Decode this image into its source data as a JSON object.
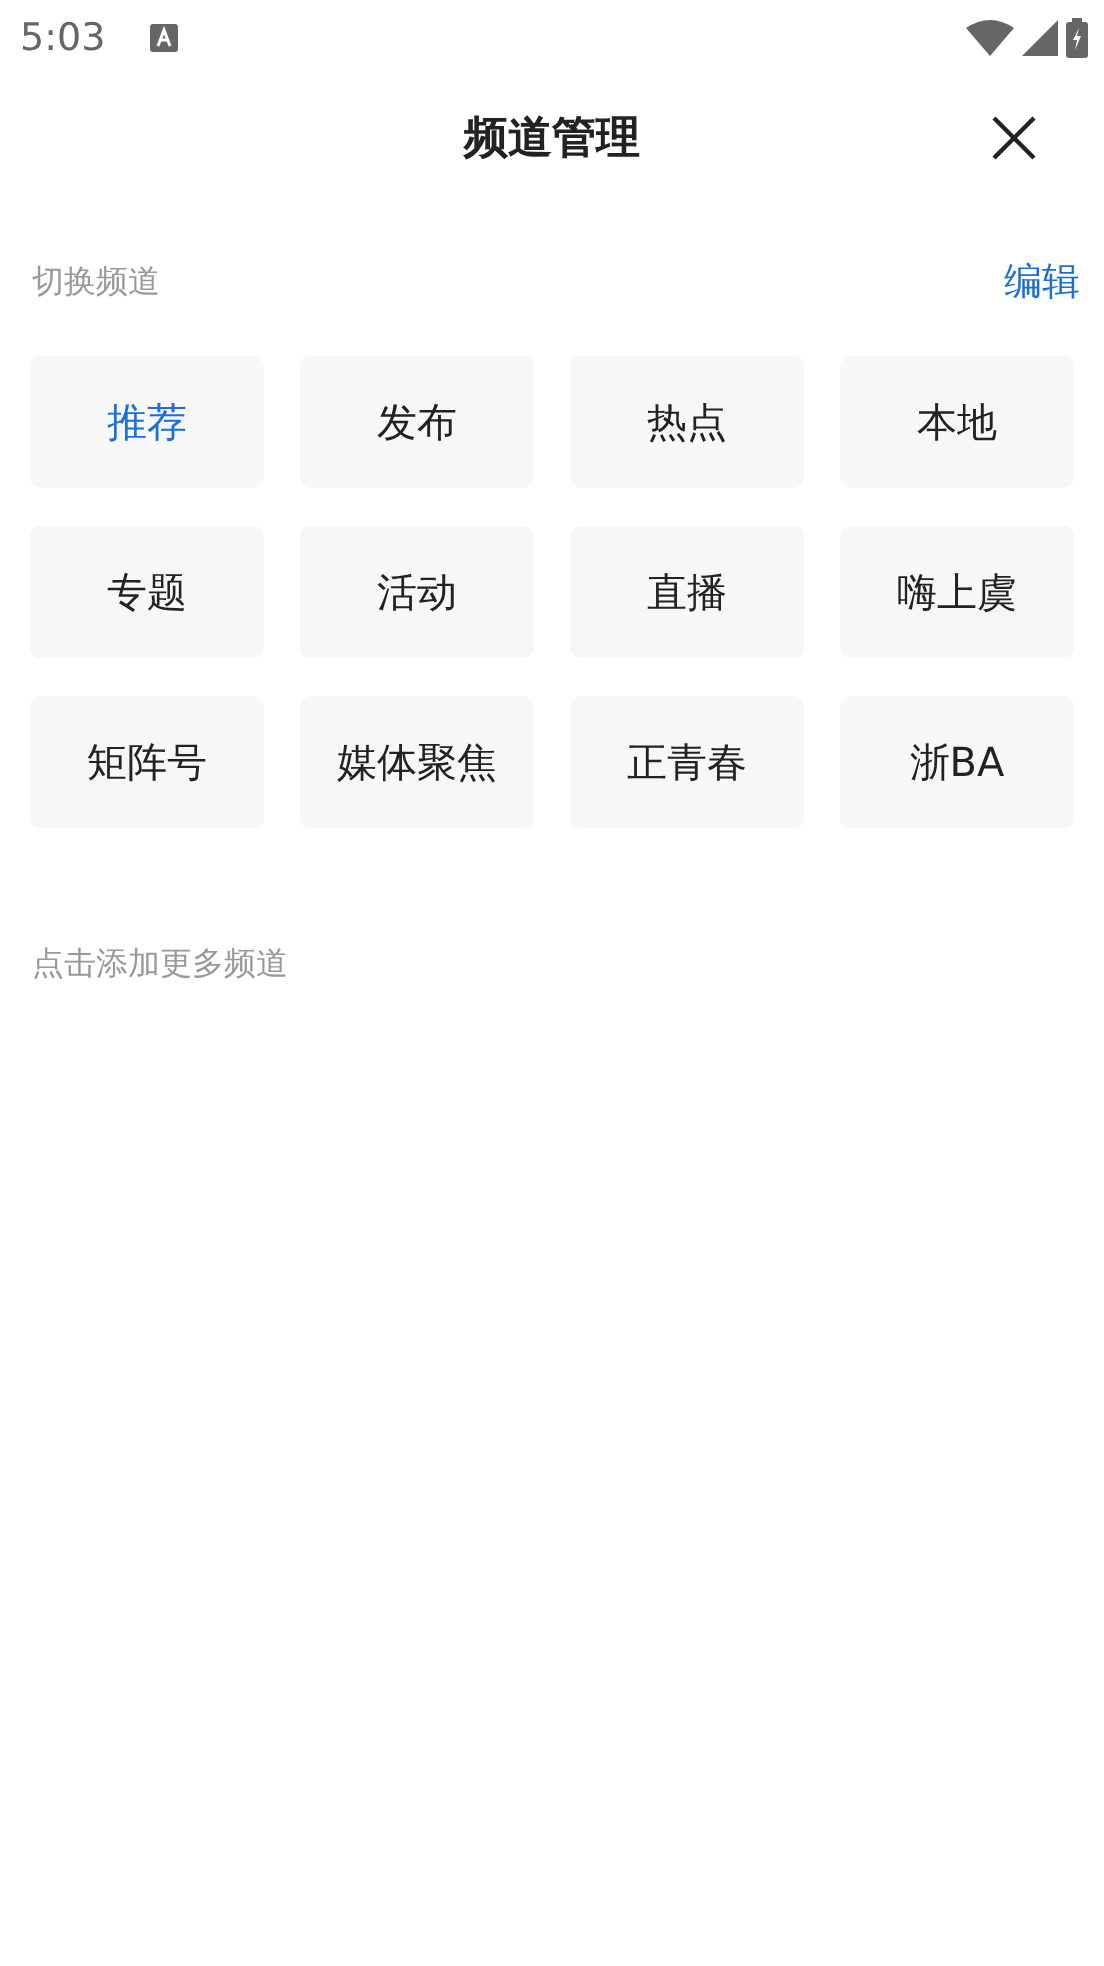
{
  "status_bar": {
    "time": "5:03"
  },
  "header": {
    "title": "频道管理"
  },
  "section": {
    "label": "切换频道",
    "action": "编辑"
  },
  "channels": [
    {
      "label": "推荐",
      "selected": true
    },
    {
      "label": "发布",
      "selected": false
    },
    {
      "label": "热点",
      "selected": false
    },
    {
      "label": "本地",
      "selected": false
    },
    {
      "label": "专题",
      "selected": false
    },
    {
      "label": "活动",
      "selected": false
    },
    {
      "label": "直播",
      "selected": false
    },
    {
      "label": "嗨上虞",
      "selected": false
    },
    {
      "label": "矩阵号",
      "selected": false
    },
    {
      "label": "媒体聚焦",
      "selected": false
    },
    {
      "label": "正青春",
      "selected": false
    },
    {
      "label": "浙BA",
      "selected": false
    }
  ],
  "more_hint": "点击添加更多频道"
}
